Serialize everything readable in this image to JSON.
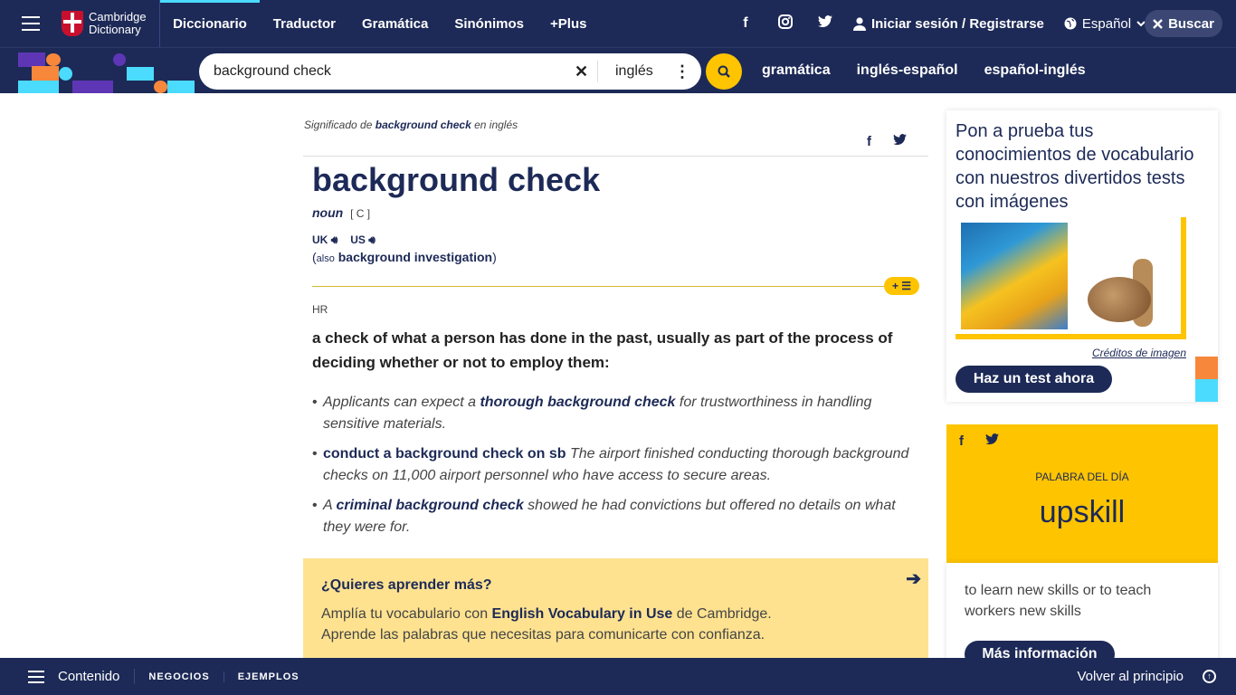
{
  "brand": {
    "line1": "Cambridge",
    "line2": "Dictionary"
  },
  "nav": {
    "items": [
      "Diccionario",
      "Traductor",
      "Gramática",
      "Sinónimos",
      "+Plus"
    ],
    "login": "Iniciar sesión / Registrarse",
    "language": "Español",
    "search_button": "Buscar"
  },
  "search": {
    "query": "background check",
    "dataset": "inglés",
    "links": [
      "gramática",
      "inglés-español",
      "español-inglés"
    ]
  },
  "entry": {
    "meaning_prefix": "Significado de",
    "meaning_word": "background check",
    "meaning_suffix": "en inglés",
    "headword": "background check",
    "pos": "noun",
    "gram": "[ C ]",
    "pron_uk": "UK",
    "pron_us": "US",
    "also_open": "(",
    "also_label": "also",
    "also_word": "background investigation",
    "also_close": ")",
    "level": "HR",
    "definition": "a check of what a person has done in the past, usually as part of the process of deciding whether or not to employ them:",
    "examples": [
      {
        "a": "Applicants can expect a ",
        "b": "thorough background check",
        "c": " for trustworthiness in handling sensitive materials."
      },
      {
        "np": "conduct a background check on sb",
        "c": " The airport finished conducting thorough background checks on 11,000 airport personnel who have access to secure areas."
      },
      {
        "a": "A ",
        "b": "criminal background check",
        "c": " showed he had convictions but offered no details on what they were for."
      }
    ]
  },
  "learn": {
    "title": "¿Quieres aprender más?",
    "line1_a": "Amplía tu vocabulario con ",
    "line1_b": "English Vocabulary in Use",
    "line1_c": " de Cambridge.",
    "line2": "Aprende las palabras que necesitas para comunicarte con confianza."
  },
  "quiz": {
    "title": "Pon a prueba tus conocimientos de vocabulario con nuestros divertidos tests con imágenes",
    "credits": "Créditos de imagen",
    "button": "Haz un test ahora"
  },
  "wotd": {
    "label": "PALABRA DEL DÍA",
    "word": "upskill",
    "definition": "to learn new skills or to teach workers new skills",
    "button": "Más información"
  },
  "bottombar": {
    "contents": "Contenido",
    "tabs": [
      "NEGOCIOS",
      "EJEMPLOS"
    ],
    "back_to_top": "Volver al principio"
  },
  "colors": {
    "navy": "#1d2a57",
    "yellow": "#fec400",
    "cyan": "#4bdbff",
    "orange": "#f7873b",
    "purple": "#5e36b5"
  },
  "icons": [
    "menu-icon",
    "facebook-icon",
    "instagram-icon",
    "twitter-icon",
    "user-icon",
    "globe-icon",
    "chevron-down-icon",
    "close-icon",
    "search-icon",
    "more-vertical-icon",
    "speaker-icon",
    "arrow-right-icon",
    "arrow-up-circle-icon"
  ]
}
